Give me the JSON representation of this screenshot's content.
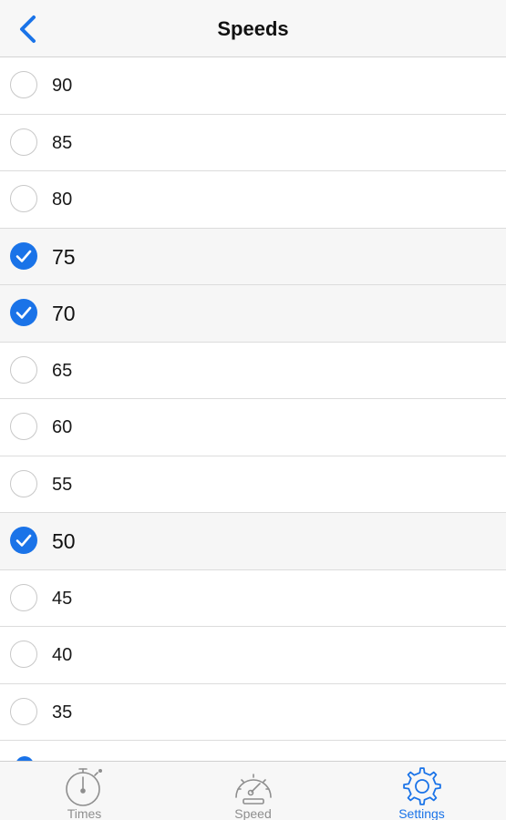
{
  "navbar": {
    "title": "Speeds",
    "back_icon": "chevron-left-icon"
  },
  "speeds": [
    {
      "label": "90",
      "checked": false
    },
    {
      "label": "85",
      "checked": false
    },
    {
      "label": "80",
      "checked": false
    },
    {
      "label": "75",
      "checked": true
    },
    {
      "label": "70",
      "checked": true
    },
    {
      "label": "65",
      "checked": false
    },
    {
      "label": "60",
      "checked": false
    },
    {
      "label": "55",
      "checked": false
    },
    {
      "label": "50",
      "checked": true
    },
    {
      "label": "45",
      "checked": false
    },
    {
      "label": "40",
      "checked": false
    },
    {
      "label": "35",
      "checked": false
    }
  ],
  "tabbar": {
    "tabs": [
      {
        "label": "Times",
        "icon": "stopwatch-icon",
        "active": false
      },
      {
        "label": "Speed",
        "icon": "speedometer-icon",
        "active": false
      },
      {
        "label": "Settings",
        "icon": "gear-icon",
        "active": true
      }
    ]
  },
  "colors": {
    "accent": "#1a73e8",
    "inactive_tab": "#8e8e8e",
    "checked_row_bg": "#f6f6f6"
  }
}
